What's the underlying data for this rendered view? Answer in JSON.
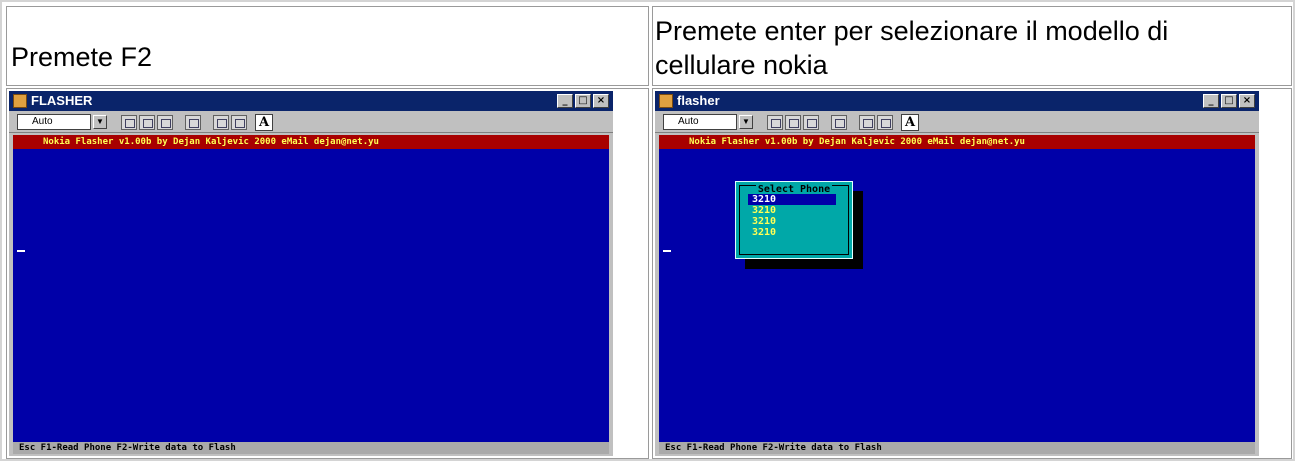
{
  "cells": {
    "left_caption": "Premete F2",
    "right_caption_line1": "Premete enter per selezionare il modello di",
    "right_caption_line2": "cellulare nokia"
  },
  "left_window": {
    "title": "FLASHER",
    "mode_select": "Auto",
    "header_line": "Nokia  Flasher v1.00b  by Dejan Kaljevic 2000        eMail dejan@net.yu",
    "status_line": "Esc  F1-Read Phone  F2-Write data to Flash"
  },
  "right_window": {
    "title": "flasher",
    "mode_select": "Auto",
    "header_line": "Nokia  Flasher v1.00b  by Dejan Kaljevic 2000        eMail dejan@net.yu",
    "status_line": "Esc  F1-Read Phone  F2-Write data to Flash",
    "dialog": {
      "title": "Select Phone",
      "items": [
        "3210",
        "3210",
        "3210",
        "3210"
      ],
      "selected_index": 0
    }
  },
  "colors": {
    "dos_background": "#0000a8",
    "header_bar": "#a80000",
    "header_text": "#ffff55",
    "dialog_background": "#00a8a8",
    "titlebar": "#0a246a"
  },
  "icons": {
    "title_buttons": [
      "minimize-icon",
      "maximize-icon",
      "close-icon"
    ],
    "toolbar": [
      "mark-icon",
      "copy-icon",
      "paste-icon",
      "fullscreen-icon",
      "properties-icon",
      "background-icon",
      "font-icon"
    ]
  }
}
